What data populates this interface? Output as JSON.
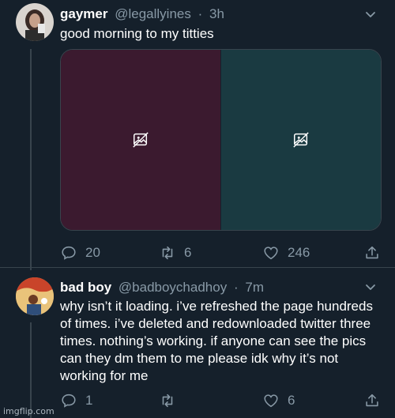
{
  "colors": {
    "background": "#15202b",
    "secondary_text": "#8899a6",
    "media_left": "#3b1a2f",
    "media_right": "#1a3a41",
    "divider": "#38444d"
  },
  "tweets": [
    {
      "display_name": "gaymer",
      "handle": "@legallyines",
      "separator": "·",
      "time": "3h",
      "text": "good morning to my titties",
      "media": [
        {
          "icon": "image-unavailable-icon"
        },
        {
          "icon": "image-unavailable-icon"
        }
      ],
      "replies": "20",
      "retweets": "6",
      "likes": "246"
    },
    {
      "display_name": "bad boy",
      "handle": "@badboychadhoy",
      "separator": "·",
      "time": "7m",
      "text": "why isn’t it loading. i’ve refreshed the page hundreds of times. i’ve deleted and redownloaded twitter three times. nothing’s working. if anyone can see the pics can they dm them to me please idk why it’s not working for me",
      "replies": "1",
      "retweets": "",
      "likes": "6"
    }
  ],
  "watermark": "imgflip.com"
}
